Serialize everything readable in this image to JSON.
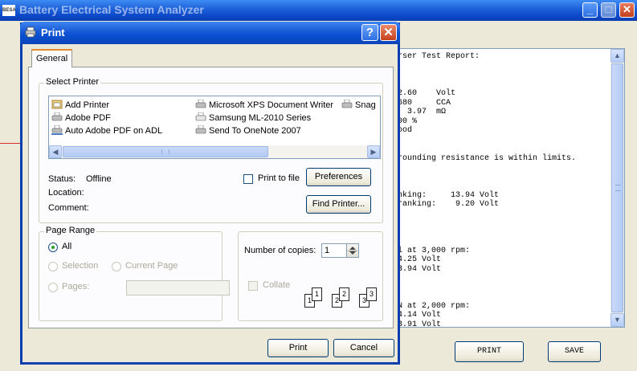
{
  "background_window": {
    "title": "Battery Electrical System Analyzer",
    "app_icon_text": "BESA",
    "report_lines": [
      "rser Test Report:",
      "",
      "",
      "",
      "2.60    Volt",
      "680     CCA",
      "  3.97  mΩ",
      "00 %",
      "ood",
      "",
      "",
      "rounding resistance is within limits.",
      "",
      "",
      "",
      "nking:     13.94 Volt",
      "ranking:    9.20 Volt",
      "",
      "",
      "",
      "",
      "l at 3,000 rpm:",
      "4.25 Volt",
      "3.94 Volt",
      "",
      "",
      "",
      "N at 2,000 rpm:",
      "4.14 Volt",
      "3.91 Volt"
    ],
    "print_button": "PRINT",
    "save_button": "SAVE"
  },
  "dialog": {
    "title": "Print",
    "help_glyph": "?",
    "close_glyph": "✕",
    "tab_general": "General",
    "select_printer_label": "Select Printer",
    "printers": [
      {
        "label": "Add Printer",
        "icon": "add-printer-icon"
      },
      {
        "label": "Adobe PDF",
        "icon": "printer-icon"
      },
      {
        "label": "Auto Adobe PDF on ADL",
        "icon": "network-printer-icon"
      },
      {
        "label": "Microsoft XPS Document Writer",
        "icon": "printer-icon"
      },
      {
        "label": "Samsung ML-2010 Series",
        "icon": "printer-icon"
      },
      {
        "label": "Send To OneNote 2007",
        "icon": "printer-icon"
      },
      {
        "label": "Snag",
        "icon": "printer-icon"
      }
    ],
    "status_label": "Status:",
    "status_value": "Offline",
    "location_label": "Location:",
    "comment_label": "Comment:",
    "print_to_file_label": "Print to file",
    "preferences_button": "Preferences",
    "find_printer_button": "Find Printer...",
    "page_range_label": "Page Range",
    "all_label": "All",
    "selection_label": "Selection",
    "current_page_label": "Current Page",
    "pages_label": "Pages:",
    "copies_label": "Number of copies:",
    "copies_value": "1",
    "collate_label": "Collate",
    "collate_pages": [
      "1",
      "1",
      "2",
      "2",
      "3",
      "3"
    ],
    "print_button": "Print",
    "cancel_button": "Cancel"
  },
  "colors": {
    "xp_title_blue": "#0a46c6",
    "dialog_face": "#ece9d8",
    "tab_accent": "#e68b2c",
    "radio_dot": "#21a121",
    "red_line": "#d2302a"
  }
}
